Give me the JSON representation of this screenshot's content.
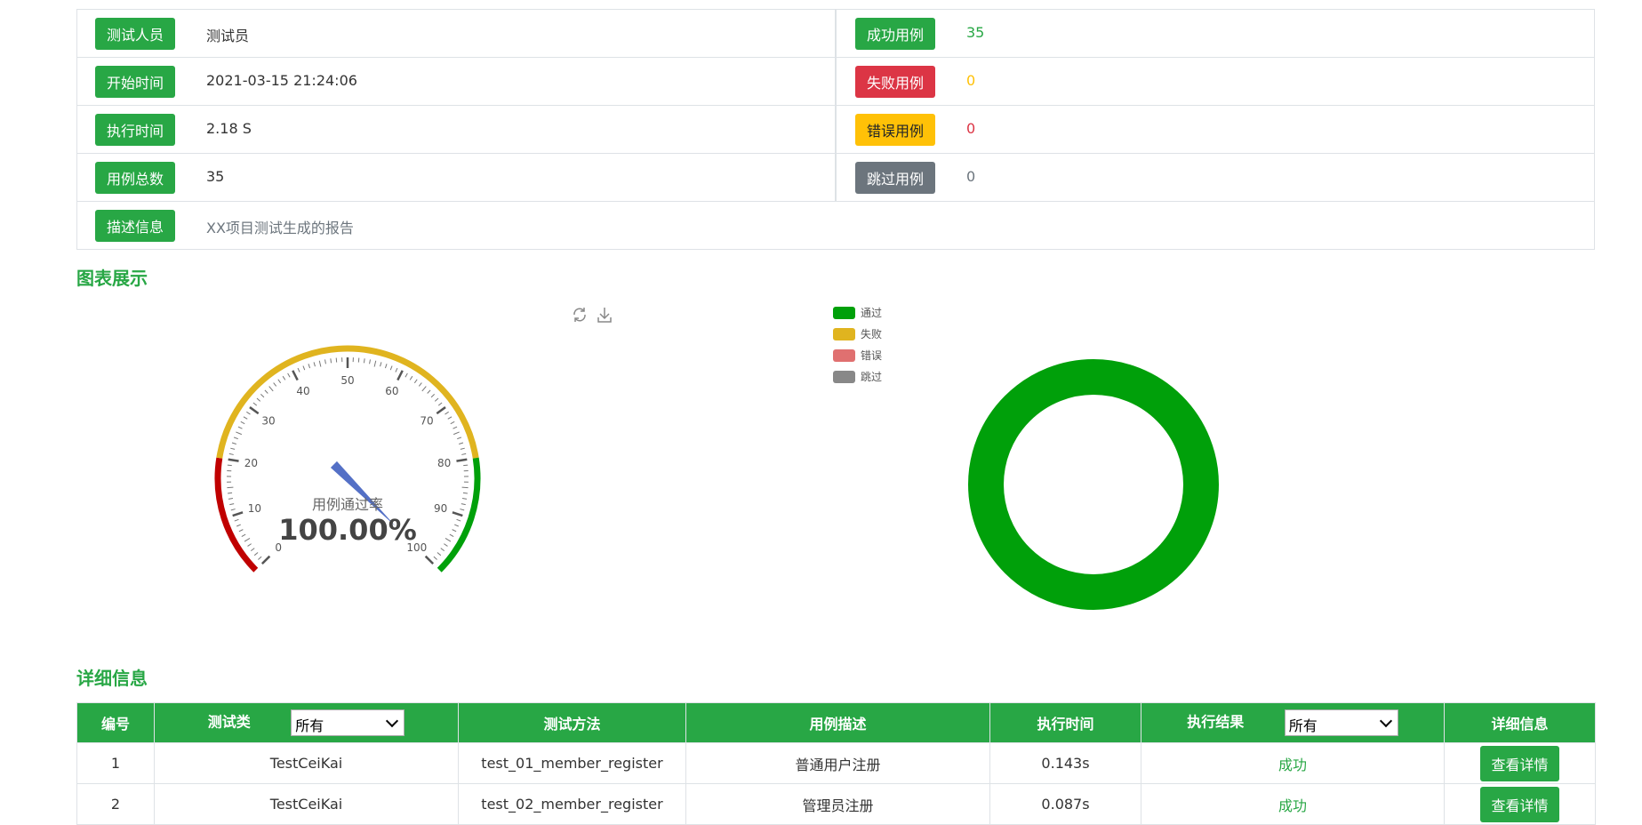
{
  "summary": {
    "left": [
      {
        "label": "测试人员",
        "value": "测试员"
      },
      {
        "label": "开始时间",
        "value": "2021-03-15 21:24:06"
      },
      {
        "label": "执行时间",
        "value": "2.18 S"
      },
      {
        "label": "用例总数",
        "value": "35"
      }
    ],
    "right": [
      {
        "label": "成功用例",
        "value": "35",
        "color": "#28a745"
      },
      {
        "label": "失败用例",
        "value": "0",
        "color": "#ffc107"
      },
      {
        "label": "错误用例",
        "value": "0",
        "color": "#dc3545"
      },
      {
        "label": "跳过用例",
        "value": "0",
        "color": "#6c757d"
      }
    ],
    "description": {
      "label": "描述信息",
      "value": "XX项目测试生成的报告"
    }
  },
  "charts_title": "图表展示",
  "details_title": "详细信息",
  "gauge": {
    "title": "用例通过率",
    "value_text": "100.00%",
    "ticks": [
      "0",
      "10",
      "20",
      "30",
      "40",
      "50",
      "60",
      "70",
      "80",
      "90",
      "100"
    ]
  },
  "chart_data": [
    {
      "type": "gauge",
      "title": "用例通过率",
      "value": 100,
      "range": [
        0,
        100
      ],
      "bands": [
        {
          "to": 20,
          "color": "#c00000"
        },
        {
          "to": 80,
          "color": "#e0b41f"
        },
        {
          "to": 100,
          "color": "#00a00a"
        }
      ]
    },
    {
      "type": "pie",
      "donut": true,
      "labels": [
        "通过",
        "失败",
        "错误",
        "跳过"
      ],
      "values": [
        35,
        0,
        0,
        0
      ],
      "colors": [
        "#00a00a",
        "#e0b41f",
        "#e07070",
        "#888888"
      ],
      "legend": "top-left"
    }
  ],
  "table": {
    "headers": [
      "编号",
      "测试类",
      "测试方法",
      "用例描述",
      "执行时间",
      "执行结果",
      "详细信息"
    ],
    "filter_all": "所有",
    "button_label": "查看详情",
    "rows": [
      {
        "id": "1",
        "cls": "TestCeiKai",
        "method": "test_01_member_register",
        "desc": "普通用户注册",
        "time": "0.143s",
        "result": "成功"
      },
      {
        "id": "2",
        "cls": "TestCeiKai",
        "method": "test_02_member_register",
        "desc": "管理员注册",
        "time": "0.087s",
        "result": "成功"
      }
    ]
  }
}
